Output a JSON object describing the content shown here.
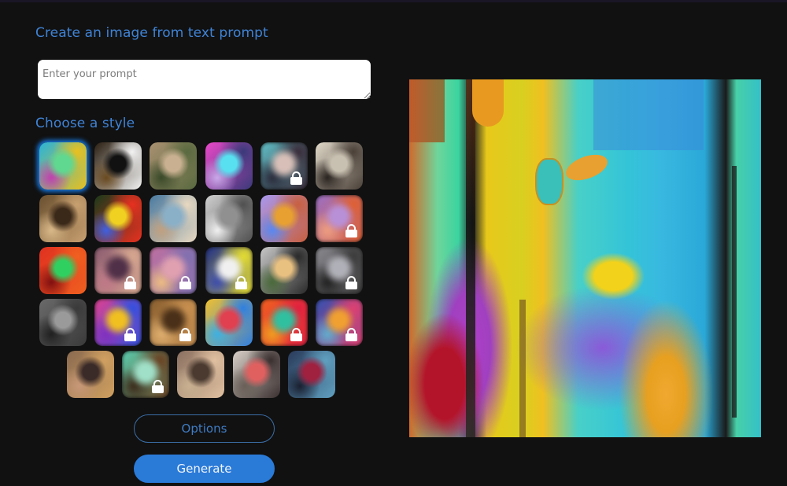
{
  "header": {
    "title": "Create an image from text prompt"
  },
  "prompt": {
    "value": "",
    "placeholder": "Enter your prompt"
  },
  "styles": {
    "heading": "Choose a style",
    "selected_index": 0,
    "tiles": [
      {
        "name": "abstract-painting",
        "locked": false,
        "colors": [
          "#2ab4d8",
          "#e8c020",
          "#60d890",
          "#c040b0"
        ]
      },
      {
        "name": "panda",
        "locked": false,
        "colors": [
          "#2a1e10",
          "#f2f2f2",
          "#111111",
          "#6a4a20"
        ]
      },
      {
        "name": "misty-forest",
        "locked": false,
        "colors": [
          "#a89070",
          "#5a6a40",
          "#c8b090",
          "#3a4a2a"
        ]
      },
      {
        "name": "robot",
        "locked": false,
        "colors": [
          "#e848c8",
          "#3a3a7a",
          "#58e0f0",
          "#c8a8e8"
        ]
      },
      {
        "name": "anime-portrait",
        "locked": true,
        "colors": [
          "#60c0c8",
          "#3a2a38",
          "#d8c0b8",
          "#2a2a3a"
        ]
      },
      {
        "name": "sketch-illustration",
        "locked": false,
        "colors": [
          "#e0d8c8",
          "#4a4038",
          "#c8c0b0",
          "#2a2420"
        ]
      },
      {
        "name": "renaissance-portrait",
        "locked": false,
        "colors": [
          "#6a5030",
          "#c8a070",
          "#3a2818",
          "#d8b888"
        ]
      },
      {
        "name": "flower-bouquet",
        "locked": false,
        "colors": [
          "#1a3a1a",
          "#e83020",
          "#f0d020",
          "#4060e0"
        ]
      },
      {
        "name": "ballet-dancers",
        "locked": false,
        "colors": [
          "#4a7aa0",
          "#e8d8c0",
          "#8ab0c8",
          "#c0a080"
        ]
      },
      {
        "name": "engraving-cup",
        "locked": false,
        "colors": [
          "#d0d0d0",
          "#505050",
          "#909090",
          "#f0f0f0"
        ]
      },
      {
        "name": "isometric-3d",
        "locked": false,
        "colors": [
          "#a898f0",
          "#c86040",
          "#e8a030",
          "#5a88f0"
        ]
      },
      {
        "name": "fox-figurine",
        "locked": true,
        "colors": [
          "#9a70c8",
          "#e06030",
          "#b890d8",
          "#f0a080"
        ]
      },
      {
        "name": "neon-face",
        "locked": false,
        "colors": [
          "#e03020",
          "#f06020",
          "#30d060",
          "#801010"
        ]
      },
      {
        "name": "fantasy-woman",
        "locked": true,
        "colors": [
          "#8a5a70",
          "#d8a890",
          "#503048",
          "#c07888"
        ]
      },
      {
        "name": "pastel-clouds",
        "locked": true,
        "colors": [
          "#c070a0",
          "#8070b0",
          "#e0a0b0",
          "#f0c080"
        ]
      },
      {
        "name": "pop-art-marilyn",
        "locked": true,
        "colors": [
          "#1a2a8a",
          "#e8e030",
          "#f0f0f0",
          "#3a4ab0"
        ]
      },
      {
        "name": "modern-architecture",
        "locked": false,
        "colors": [
          "#c8c8c8",
          "#2a2a2a",
          "#e8c080",
          "#4a6a3a"
        ]
      },
      {
        "name": "dark-cloud",
        "locked": true,
        "colors": [
          "#8a8a90",
          "#3a3a3a",
          "#b0b0b8",
          "#202020"
        ]
      },
      {
        "name": "grunge-texture",
        "locked": false,
        "colors": [
          "#6a6a6a",
          "#3a3a3a",
          "#9a9a9a",
          "#202020"
        ]
      },
      {
        "name": "neon-rabbit",
        "locked": true,
        "colors": [
          "#e04090",
          "#3050e0",
          "#f0c020",
          "#8030c0"
        ]
      },
      {
        "name": "golden-smoke",
        "locked": true,
        "colors": [
          "#8a6030",
          "#c89050",
          "#4a3018",
          "#e0b070"
        ]
      },
      {
        "name": "icon-grid",
        "locked": false,
        "colors": [
          "#f0c030",
          "#3080e0",
          "#e04050",
          "#40b0e0"
        ]
      },
      {
        "name": "neon-dragon",
        "locked": true,
        "colors": [
          "#f06020",
          "#e02040",
          "#30c0a0",
          "#f0a020"
        ]
      },
      {
        "name": "colorful-portrait",
        "locked": true,
        "colors": [
          "#3050b0",
          "#e04070",
          "#f0a030",
          "#60b0d0"
        ]
      },
      {
        "name": "warrior-helmet",
        "locked": false,
        "colors": [
          "#8a6a50",
          "#d0a060",
          "#3a2a28",
          "#c89878"
        ]
      },
      {
        "name": "forest-spirit",
        "locked": true,
        "colors": [
          "#5ad0b0",
          "#6a4020",
          "#a0e0c8",
          "#3a2818"
        ]
      },
      {
        "name": "victorian-lady",
        "locked": false,
        "colors": [
          "#8a7060",
          "#e0c0a0",
          "#4a3a30",
          "#c8b090"
        ]
      },
      {
        "name": "sketch-man-hat",
        "locked": false,
        "colors": [
          "#d8d0c8",
          "#3a3030",
          "#e06060",
          "#6a6058"
        ]
      },
      {
        "name": "blue-face",
        "locked": false,
        "colors": [
          "#2a3a5a",
          "#60a0c0",
          "#a02040",
          "#1a2030"
        ]
      }
    ]
  },
  "buttons": {
    "options": "Options",
    "generate": "Generate"
  },
  "result": {
    "alt": "Generated abstract painting"
  }
}
